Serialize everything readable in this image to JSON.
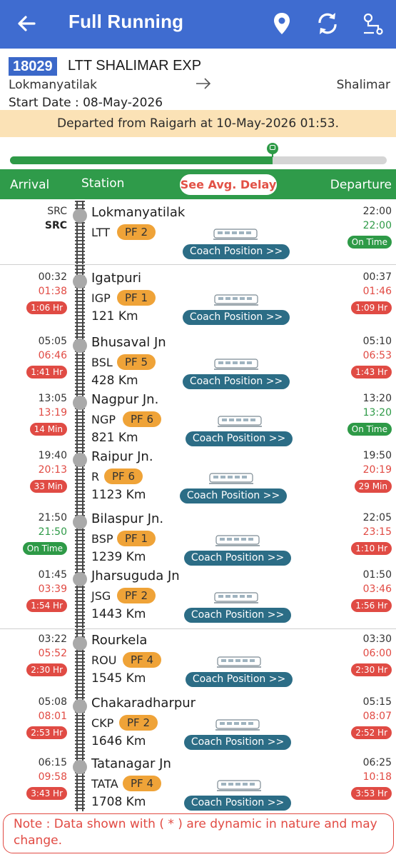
{
  "appbar": {
    "title": "Full Running",
    "icons": [
      "back-arrow-icon",
      "location-pin-icon",
      "refresh-icon",
      "route-icon"
    ]
  },
  "train": {
    "number": "18029",
    "name": "LTT SHALIMAR EXP",
    "from": "Lokmanyatilak",
    "to": "Shalimar",
    "start_date": "Start Date : 08-May-2026"
  },
  "status_banner": "Departed from Raigarh at 10-May-2026 01:53.",
  "progress": {
    "fraction": 0.697
  },
  "columns": {
    "arrival": "Arrival",
    "station": "Station",
    "delay_button": "See Avg. Delay",
    "departure": "Departure"
  },
  "coach_label": "Coach Position >>",
  "stations": [
    {
      "name": "Lokmanyatilak",
      "code": "LTT",
      "pf": "PF 2",
      "km": "",
      "sch_arr": "SRC",
      "act_arr": "SRC",
      "arr_delay": "",
      "sch_dep": "22:00",
      "act_dep": "22:00",
      "dep_delay": "On Time"
    },
    {
      "name": "Igatpuri",
      "code": "IGP",
      "pf": "PF 1",
      "km": "121 Km",
      "sch_arr": "00:32",
      "act_arr": "01:38",
      "arr_delay": "1:06 Hr",
      "sch_dep": "00:37",
      "act_dep": "01:46",
      "dep_delay": "1:09 Hr"
    },
    {
      "name": "Bhusaval Jn",
      "code": "BSL",
      "pf": "PF 5",
      "km": "428 Km",
      "sch_arr": "05:05",
      "act_arr": "06:46",
      "arr_delay": "1:41 Hr",
      "sch_dep": "05:10",
      "act_dep": "06:53",
      "dep_delay": "1:43 Hr"
    },
    {
      "name": "Nagpur Jn.",
      "code": "NGP",
      "pf": "PF 6",
      "km": "821 Km",
      "sch_arr": "13:05",
      "act_arr": "13:19",
      "arr_delay": "14 Min",
      "sch_dep": "13:20",
      "act_dep": "13:20",
      "dep_delay": "On Time"
    },
    {
      "name": "Raipur Jn.",
      "code": "R",
      "pf": "PF 6",
      "km": "1123 Km",
      "sch_arr": "19:40",
      "act_arr": "20:13",
      "arr_delay": "33 Min",
      "sch_dep": "19:50",
      "act_dep": "20:19",
      "dep_delay": "29 Min"
    },
    {
      "name": "Bilaspur Jn.",
      "code": "BSP",
      "pf": "PF 1",
      "km": "1239 Km",
      "sch_arr": "21:50",
      "act_arr": "21:50",
      "arr_delay": "On Time",
      "sch_dep": "22:05",
      "act_dep": "23:15",
      "dep_delay": "1:10 Hr"
    },
    {
      "name": "Jharsuguda Jn",
      "code": "JSG",
      "pf": "PF 2",
      "km": "1443 Km",
      "sch_arr": "01:45",
      "act_arr": "03:39",
      "arr_delay": "1:54 Hr",
      "sch_dep": "01:50",
      "act_dep": "03:46",
      "dep_delay": "1:56 Hr"
    },
    {
      "name": "Rourkela",
      "code": "ROU",
      "pf": "PF 4",
      "km": "1545 Km",
      "sch_arr": "03:22",
      "act_arr": "05:52",
      "arr_delay": "2:30 Hr",
      "sch_dep": "03:30",
      "act_dep": "06:00",
      "dep_delay": "2:30 Hr"
    },
    {
      "name": "Chakaradharpur",
      "code": "CKP",
      "pf": "PF 2",
      "km": "1646 Km",
      "sch_arr": "05:08",
      "act_arr": "08:01",
      "arr_delay": "2:53 Hr",
      "sch_dep": "05:15",
      "act_dep": "08:07",
      "dep_delay": "2:52 Hr"
    },
    {
      "name": "Tatanagar Jn",
      "code": "TATA",
      "pf": "PF 4",
      "km": "1708 Km",
      "sch_arr": "06:15",
      "act_arr": "09:58",
      "arr_delay": "3:43 Hr",
      "sch_dep": "06:25",
      "act_dep": "10:18",
      "dep_delay": "3:53 Hr"
    }
  ],
  "note": "Note : Data shown with ( * ) are dynamic in nature and may change.",
  "colors": {
    "appbar": "#3f6cd0",
    "header_green": "#2f9b4a",
    "late": "#e14a43",
    "on_time": "#2e9a47",
    "pf_badge": "#efa338",
    "coach_button": "#2c6d86",
    "banner": "#fbe2b6"
  }
}
